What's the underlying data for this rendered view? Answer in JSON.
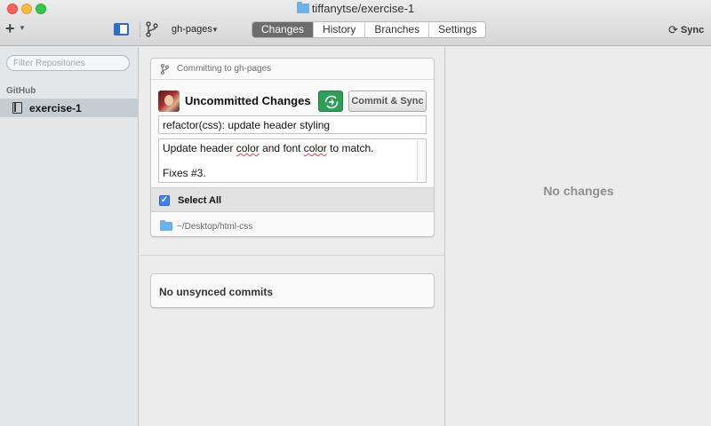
{
  "window": {
    "title": "tiffanytse/exercise-1"
  },
  "toolbar": {
    "add_label": "+",
    "branch_name": "gh-pages",
    "tabs": [
      {
        "label": "Changes",
        "active": true
      },
      {
        "label": "History",
        "active": false
      },
      {
        "label": "Branches",
        "active": false
      },
      {
        "label": "Settings",
        "active": false
      }
    ],
    "sync_label": "Sync"
  },
  "sidebar": {
    "filter_placeholder": "Filter Repositories",
    "section": "GitHub",
    "repos": [
      {
        "name": "exercise-1",
        "selected": true
      }
    ]
  },
  "commit": {
    "committing_to": "Committing to gh-pages",
    "title": "Uncommitted Changes",
    "commit_button": "Commit & Sync",
    "summary": "refactor(css): update header styling",
    "description_lines": [
      {
        "pre": "Update header ",
        "squig1": "color",
        "mid": " and font ",
        "squig2": "color",
        "post": " to match."
      },
      {
        "text": ""
      },
      {
        "text": "Fixes #3."
      }
    ],
    "select_all_label": "Select All",
    "select_all_checked": true,
    "path": "~/Desktop/html-css"
  },
  "unsynced": {
    "label": "No unsynced commits"
  },
  "detail": {
    "empty_label": "No changes"
  },
  "colors": {
    "accent_blue": "#2f6bcf",
    "sync_green": "#2e9f57",
    "active_tab": "#6c6c6c"
  }
}
